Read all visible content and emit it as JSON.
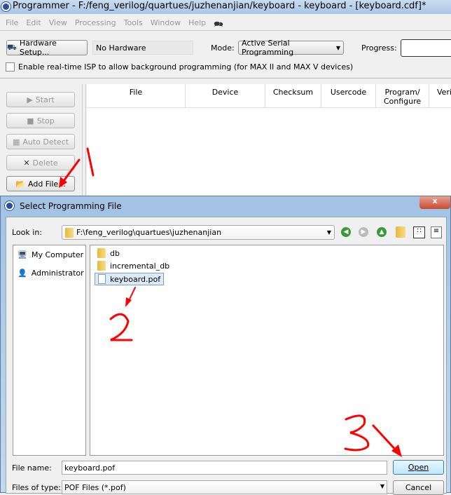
{
  "window": {
    "title": "Programmer - F:/feng_verilog/quartues/juzhenanjian/keyboard - keyboard - [keyboard.cdf]*"
  },
  "menu": [
    "File",
    "Edit",
    "View",
    "Processing",
    "Tools",
    "Window",
    "Help"
  ],
  "toolbar": {
    "hardware_setup": "Hardware Setup...",
    "hardware_value": "No Hardware",
    "mode_label": "Mode:",
    "mode_value": "Active Serial Programming",
    "progress_label": "Progress:"
  },
  "isp_checkbox": {
    "label": "Enable real-time ISP to allow background programming (for MAX II and MAX V devices)",
    "checked": false
  },
  "side_buttons": {
    "start": "Start",
    "stop": "Stop",
    "auto_detect": "Auto Detect",
    "delete": "Delete",
    "add_file": "Add File..."
  },
  "table": {
    "columns": [
      "File",
      "Device",
      "Checksum",
      "Usercode",
      "Program/ Configure",
      "Verify"
    ]
  },
  "dialog": {
    "title": "Select Programming File",
    "look_in_label": "Look in:",
    "look_in_value": "F:\\feng_verilog\\quartues\\juzhenanjian",
    "places": [
      "My Computer",
      "Administrator"
    ],
    "files": [
      {
        "name": "db",
        "type": "folder"
      },
      {
        "name": "incremental_db",
        "type": "folder"
      },
      {
        "name": "keyboard.pof",
        "type": "file",
        "selected": true
      }
    ],
    "file_name_label": "File name:",
    "file_name_value": "keyboard.pof",
    "file_type_label": "Files of type:",
    "file_type_value": "POF Files (*.pof)",
    "open": "Open",
    "cancel": "Cancel"
  },
  "annotations": {
    "color": "#ff0000",
    "steps": [
      "1",
      "2",
      "3"
    ]
  }
}
